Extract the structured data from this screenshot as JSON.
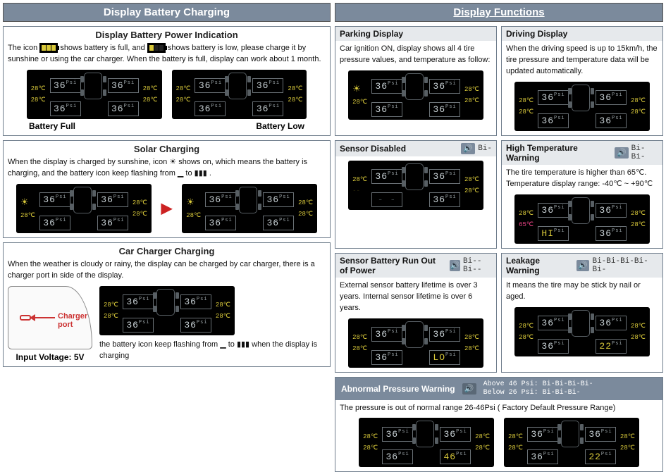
{
  "left": {
    "header": "Display Battery Charging",
    "battery": {
      "title": "Display Battery Power Indication",
      "desc1": "The icon ",
      "desc2": " shows battery is full, and ",
      "desc3": " shows battery is low, please charge it by sunshine or using the car charger. When the battery is full, display can work about 1 month.",
      "cap_full": "Battery Full",
      "cap_low": "Battery Low"
    },
    "solar": {
      "title": "Solar Charging",
      "desc": "When the display is charged by sunshine, icon ☀ shows on, which means the battery is charging, and the battery icon keep flashing from ▁ to ▮▮▮ ."
    },
    "charger": {
      "title": "Car Charger Charging",
      "desc": "When the weather is cloudy or rainy, the display can be charged by car charger, there is a charger port in side of the display.",
      "port_label": "Charger port",
      "input_v": "Input Voltage: 5V",
      "flash_note": "the battery icon keep flashing from ▁ to ▮▮▮ when the display is charging"
    }
  },
  "right": {
    "header": "Display Functions",
    "parking": {
      "title": "Parking Display",
      "desc": "Car ignition ON, display shows all 4 tire pressure values, and temperature as follow:"
    },
    "driving": {
      "title": "Driving Display",
      "desc": "When the driving speed is up to 15km/h, the tire pressure and temperature data will be updated automatically."
    },
    "sensor_disabled": {
      "title": "Sensor Disabled",
      "sound": "Bi-"
    },
    "high_temp": {
      "title": "High Temperature Warning",
      "sound": "Bi-Bi-",
      "desc": "The tire temperature is higher than 65℃. Temperature display range: -40℃ ~ +90℃"
    },
    "sensor_batt": {
      "title": "Sensor Battery Run Out of Power",
      "sound": "Bi--Bi--",
      "desc": "External sensor battery lifetime is over 3 years. Internal sensor lifetime is over 6 years."
    },
    "leakage": {
      "title": "Leakage Warning",
      "sound": "Bi-Bi-Bi-Bi-Bi-",
      "desc": "It means the tire may be stick by nail or aged."
    },
    "abnormal": {
      "title": "Abnormal Pressure Warning",
      "sound_above": "Above 46 Psi: Bi-Bi-Bi-Bi-",
      "sound_below": "Below 26 Psi: Bi-Bi-Bi-",
      "desc": "The pressure is out of normal range 26-46Psi ( Factory Default Pressure Range)"
    }
  },
  "lcd": {
    "psi": "36",
    "unit": "Psi",
    "temp": "28℃",
    "hi": "HI",
    "lo": "LO",
    "dash": "- -",
    "hot": "65℃",
    "p46": "46",
    "p22": "22"
  }
}
